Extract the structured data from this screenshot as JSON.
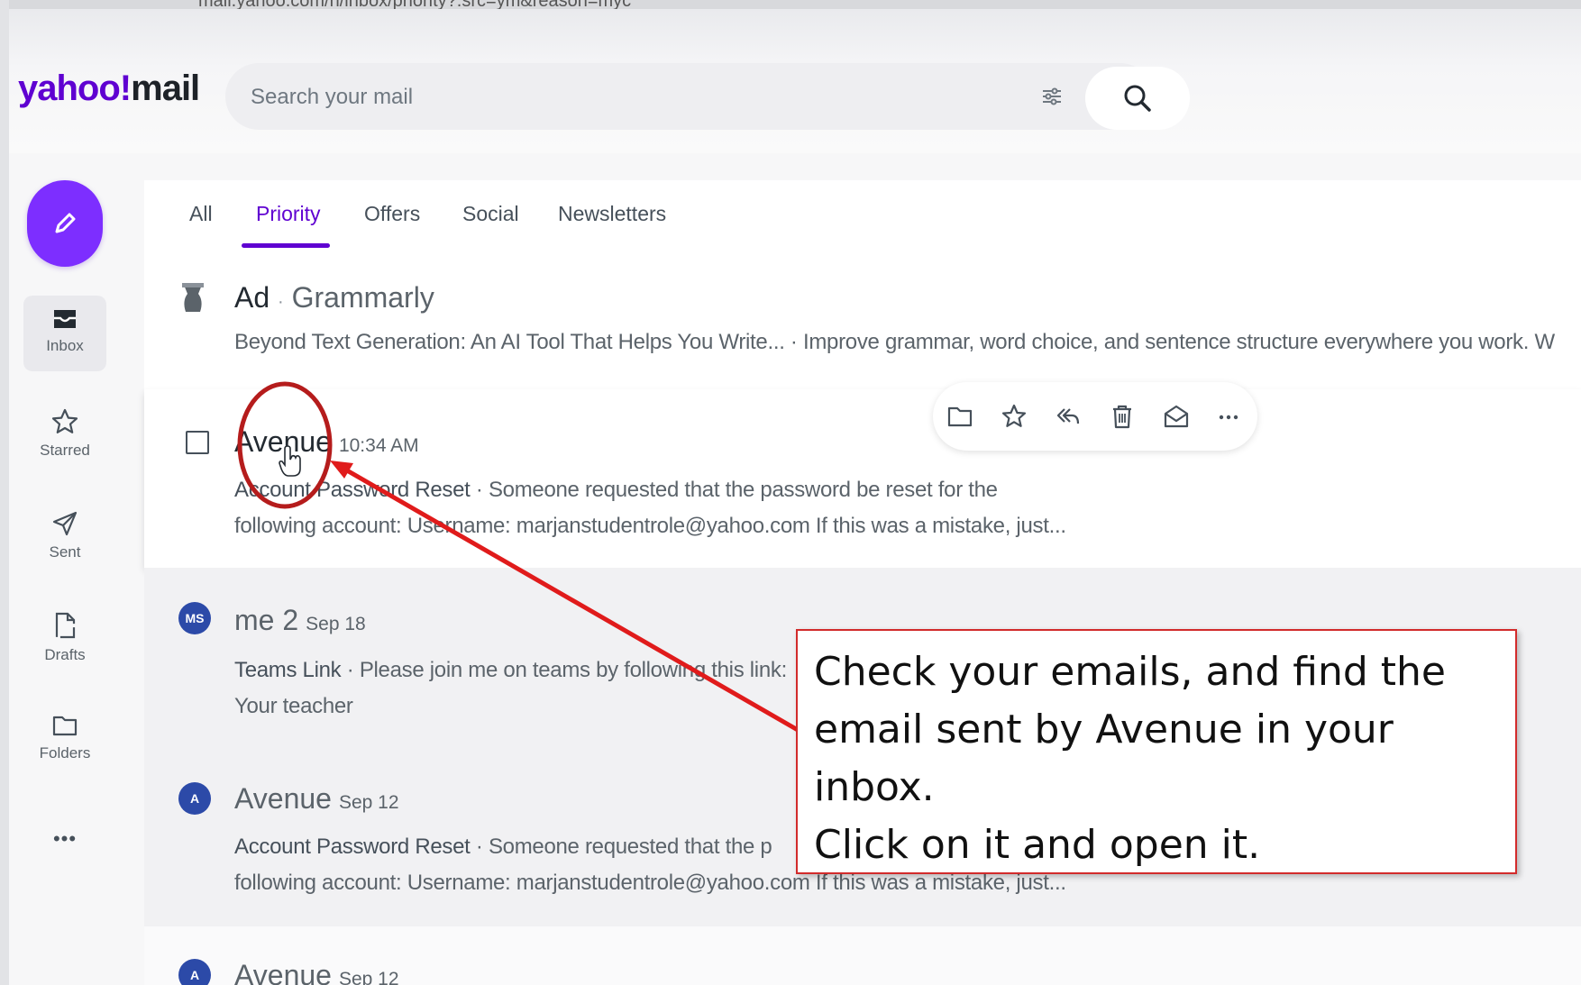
{
  "browser": {
    "url": "mail.yahoo.com/n/inbox/priority?.src=ym&reason=myc"
  },
  "logo": {
    "part1": "yahoo",
    "slash": "!",
    "part2": "mail"
  },
  "search": {
    "placeholder": "Search your mail",
    "value": "",
    "filter_icon": "sliders-icon",
    "search_icon": "search-icon"
  },
  "compose": {
    "icon": "pencil-icon"
  },
  "nav": {
    "items": [
      {
        "label": "Inbox",
        "icon": "inbox-icon",
        "active": true
      },
      {
        "label": "Starred",
        "icon": "star-icon"
      },
      {
        "label": "Sent",
        "icon": "paper-plane-icon"
      },
      {
        "label": "Drafts",
        "icon": "draft-icon"
      },
      {
        "label": "Folders",
        "icon": "folder-icon"
      },
      {
        "label": "•••",
        "icon": "more-icon"
      }
    ]
  },
  "tabs": [
    {
      "label": "All"
    },
    {
      "label": "Priority",
      "active": true
    },
    {
      "label": "Offers"
    },
    {
      "label": "Social"
    },
    {
      "label": "Newsletters"
    }
  ],
  "emails": {
    "ad": {
      "tag": "Ad",
      "separator": "·",
      "sender": "Grammarly",
      "preview": "Beyond Text Generation: An AI Tool That Helps You Write... · Improve grammar, word choice, and sentence structure everywhere you work. W"
    },
    "hovered": {
      "sender": "Avenue",
      "time": "10:34 AM",
      "subject": "Account Password Reset",
      "preview1": " · Someone requested that the password be reset for the",
      "preview2": "following account: Username: marjanstudentrole@yahoo.com If this was a mistake, just..."
    },
    "me": {
      "avatar": "MS",
      "sender": "me 2",
      "time": "Sep 18",
      "subject": "Teams Link",
      "preview1": " · Please join me on teams by following this link:",
      "preview2": "Your teacher"
    },
    "avenue2": {
      "avatar": "A",
      "sender": "Avenue",
      "time": "Sep 12",
      "subject": "Account Password Reset",
      "preview1": " · Someone requested that the p",
      "preview2": "following account: Username: marjanstudentrole@yahoo.com If this was a mistake, just..."
    },
    "avenue3": {
      "avatar": "A",
      "sender": "Avenue",
      "time": "Sep 12"
    }
  },
  "row_actions": [
    "folder-icon",
    "star-icon",
    "reply-all-icon",
    "trash-icon",
    "envelope-open-icon",
    "more-icon"
  ],
  "annotation": {
    "lines": [
      "Check your emails, and find the",
      "email sent by Avenue in your",
      "inbox.",
      "Click on it and open it."
    ],
    "color": "#d22b2b"
  },
  "colors": {
    "brand": "#5f01d1",
    "compose": "#7d2eff",
    "avatar": "#2c4aa8"
  }
}
